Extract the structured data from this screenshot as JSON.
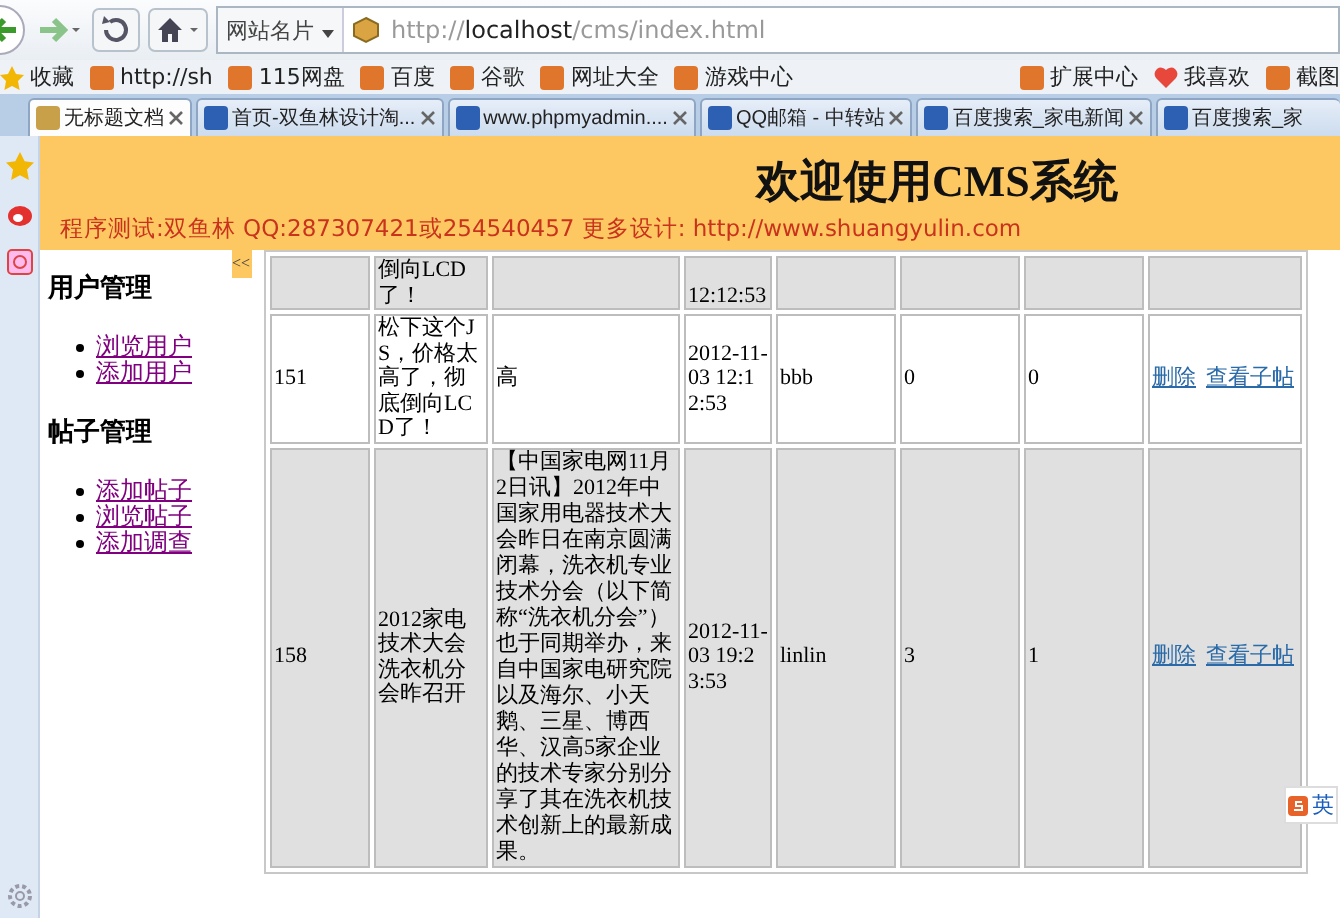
{
  "address_bar": {
    "site_menu": "网站名片",
    "url": "http://**localhost**/cms/index.html"
  },
  "bookmarks": [
    {
      "label": "收藏",
      "kind": "star"
    },
    {
      "label": "http://sh",
      "kind": "site"
    },
    {
      "label": "115网盘",
      "kind": "site"
    },
    {
      "label": "百度",
      "kind": "site"
    },
    {
      "label": "谷歌",
      "kind": "site"
    },
    {
      "label": "网址大全",
      "kind": "site"
    },
    {
      "label": "游戏中心",
      "kind": "site"
    }
  ],
  "bookmarks_right": [
    {
      "label": "扩展中心",
      "kind": "site"
    },
    {
      "label": "我喜欢",
      "kind": "heart"
    },
    {
      "label": "截图",
      "kind": "site"
    }
  ],
  "tabs": [
    {
      "title": "无标题文档",
      "selected": true
    },
    {
      "title": "首页-双鱼林设计淘...",
      "selected": false
    },
    {
      "title": "www.phpmyadmin....",
      "selected": false
    },
    {
      "title": "QQ邮箱 - 中转站",
      "selected": false
    },
    {
      "title": "百度搜索_家电新闻",
      "selected": false
    },
    {
      "title": "百度搜索_家",
      "selected": false
    }
  ],
  "header": {
    "title": "欢迎使用CMS系统",
    "subtitle": "程序测试:双鱼林 QQ:287307421或254540457 更多设计: http://www.shuangyulin.com"
  },
  "sidebar": {
    "toggle": "<<",
    "sections": [
      {
        "heading": "用户管理",
        "links": [
          "浏览用户",
          "添加用户"
        ]
      },
      {
        "heading": "帖子管理",
        "links": [
          "添加帖子",
          "浏览帖子",
          "添加调查"
        ]
      }
    ]
  },
  "table": {
    "rows": [
      {
        "shaded": true,
        "cells": {
          "column_2": "倒向LCD了！",
          "column_4": "12:12:53"
        }
      },
      {
        "shaded": false,
        "cells": {
          "column_1": "151",
          "column_2": "松下这个JS，价格太高了，彻底倒向LCD了！",
          "column_3": "高",
          "column_4": "2012-11-03 12:12:53",
          "column_5": "bbb",
          "column_6": "0",
          "column_7": "0"
        },
        "actions": [
          "删除",
          "查看子帖"
        ]
      },
      {
        "shaded": true,
        "cells": {
          "column_1": "158",
          "column_2": "2012家电技术大会洗衣机分会昨召开",
          "column_3": "【中国家电网11月2日讯】2012年中国家用电器技术大会昨日在南京圆满闭幕，洗衣机专业技术分会（以下简称“洗衣机分会”）也于同期举办，来自中国家电研究院以及海尔、小天鹅、三星、博西华、汉高5家企业的技术专家分别分享了其在洗衣机技术创新上的最新成果。",
          "column_4": "2012-11-03 19:23:53",
          "column_5": "linlin",
          "column_6": "3",
          "column_7": "1"
        },
        "actions": [
          "删除",
          "查看子帖"
        ]
      }
    ]
  },
  "ime": {
    "label": "英"
  }
}
